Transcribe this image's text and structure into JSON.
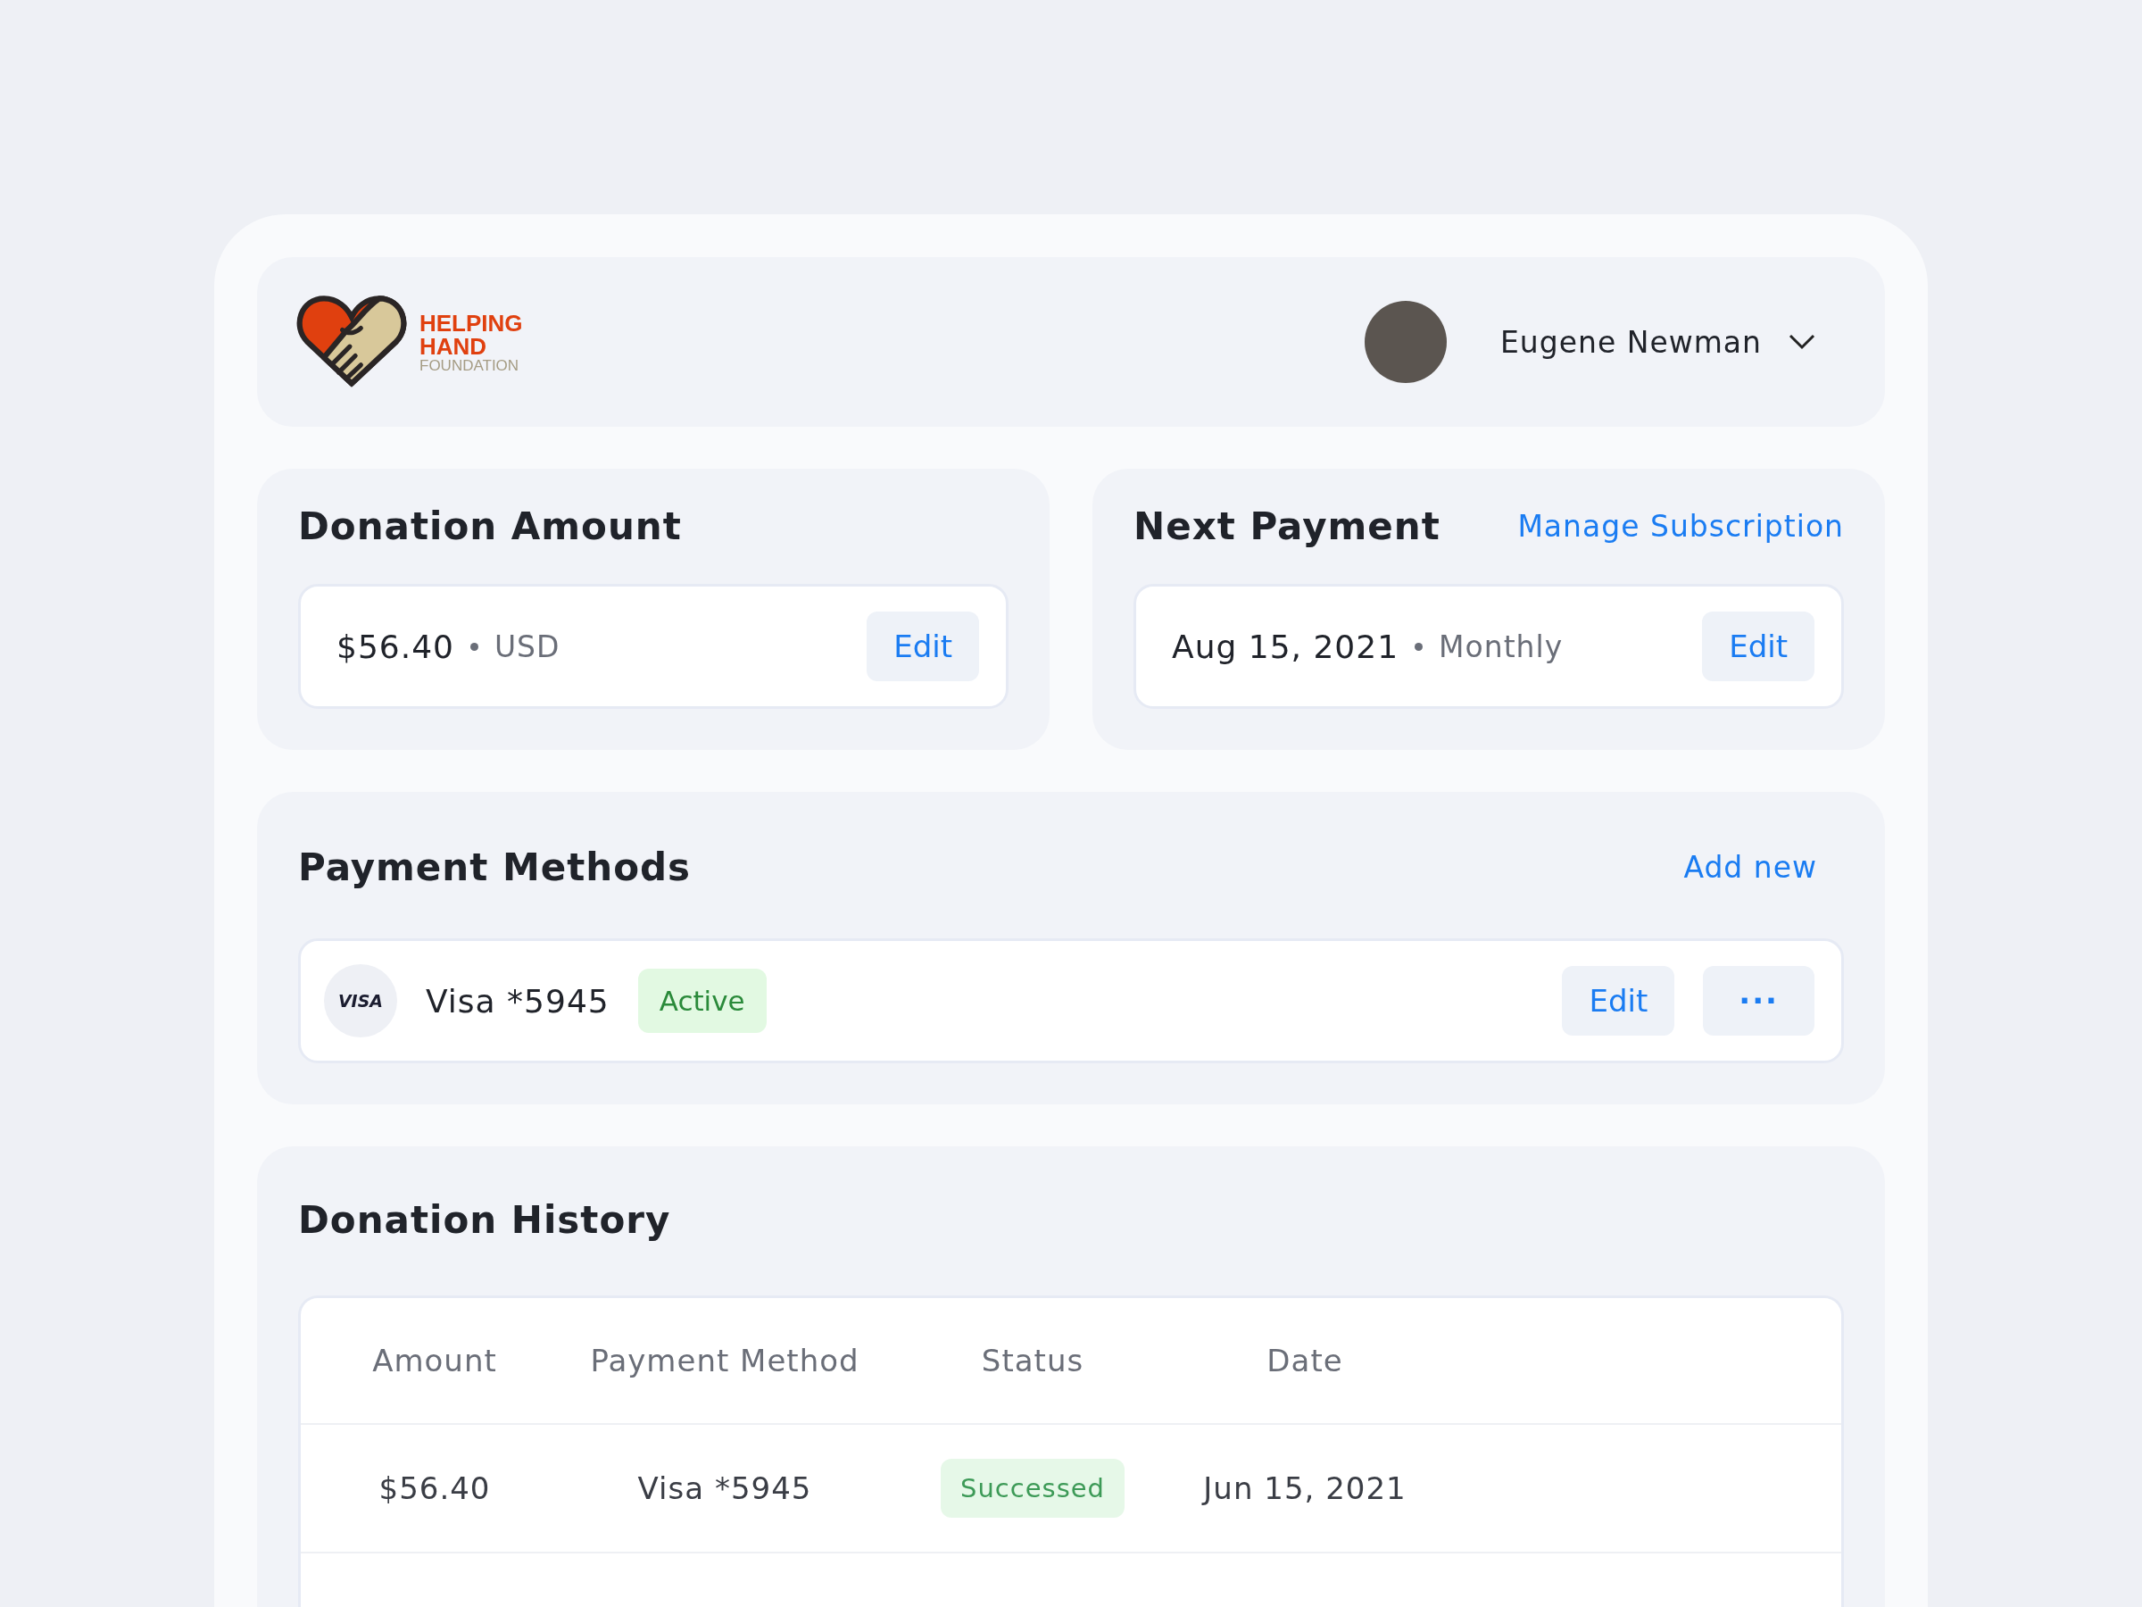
{
  "header": {
    "logo": {
      "line_1": "HELPING",
      "line_2": "HAND",
      "line_3": "FOUNDATION"
    },
    "user": {
      "name": "Eugene Newman"
    }
  },
  "donation_amount": {
    "title": "Donation Amount",
    "amount": "$56.40",
    "currency": "USD",
    "edit": "Edit"
  },
  "next_payment": {
    "title": "Next Payment",
    "link": "Manage Subscription",
    "date": "Aug 15, 2021",
    "frequency": "Monthly",
    "edit": "Edit"
  },
  "payment_methods": {
    "title": "Payment Methods",
    "add": "Add new",
    "items": [
      {
        "brand": "VISA",
        "name": "Visa *5945",
        "badge": "Active",
        "edit": "Edit",
        "more": "···"
      }
    ]
  },
  "donation_history": {
    "title": "Donation History",
    "columns": [
      "Amount",
      "Payment Method",
      "Status",
      "Date"
    ],
    "rows": [
      {
        "amount": "$56.40",
        "method": "Visa *5945",
        "status": "Successed",
        "date": "Jun 15, 2021"
      }
    ]
  }
}
